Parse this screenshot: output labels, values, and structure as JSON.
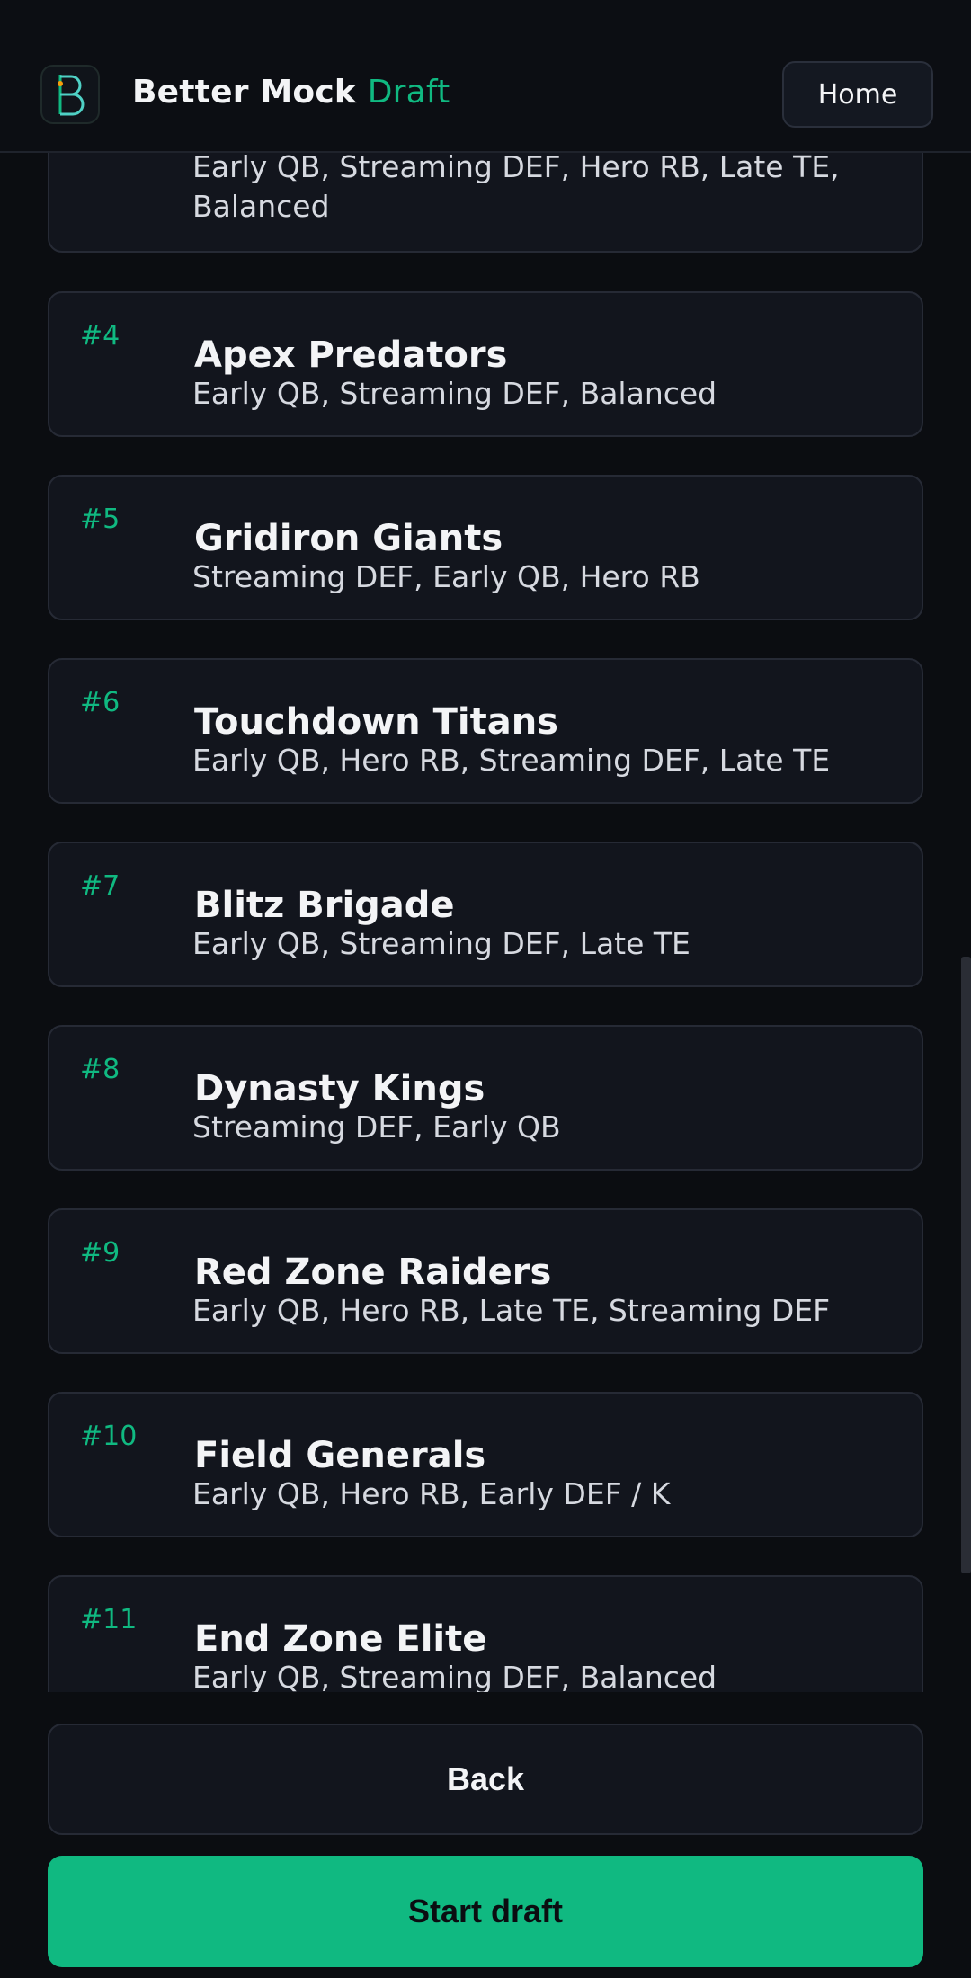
{
  "header": {
    "brand_main": "Better Mock",
    "brand_accent": "Draft",
    "logo_letter": "B",
    "home_label": "Home"
  },
  "teams": [
    {
      "rank": "",
      "name": "",
      "strategies": "Early QB, Streaming DEF, Hero RB, Late TE, Balanced"
    },
    {
      "rank": "#4",
      "name": "Apex Predators",
      "strategies": "Early QB, Streaming DEF, Balanced"
    },
    {
      "rank": "#5",
      "name": "Gridiron Giants",
      "strategies": "Streaming DEF, Early QB, Hero RB"
    },
    {
      "rank": "#6",
      "name": "Touchdown Titans",
      "strategies": "Early QB, Hero RB, Streaming DEF, Late TE"
    },
    {
      "rank": "#7",
      "name": "Blitz Brigade",
      "strategies": "Early QB, Streaming DEF, Late TE"
    },
    {
      "rank": "#8",
      "name": "Dynasty Kings",
      "strategies": "Streaming DEF, Early QB"
    },
    {
      "rank": "#9",
      "name": "Red Zone Raiders",
      "strategies": "Early QB, Hero RB, Late TE, Streaming DEF"
    },
    {
      "rank": "#10",
      "name": "Field Generals",
      "strategies": "Early QB, Hero RB, Early DEF / K"
    },
    {
      "rank": "#11",
      "name": "End Zone Elite",
      "strategies": "Early QB, Streaming DEF, Balanced"
    }
  ],
  "footer": {
    "back_label": "Back",
    "start_label": "Start draft"
  },
  "colors": {
    "accent": "#10b981",
    "background": "#0b0d11",
    "card": "#12151d"
  }
}
